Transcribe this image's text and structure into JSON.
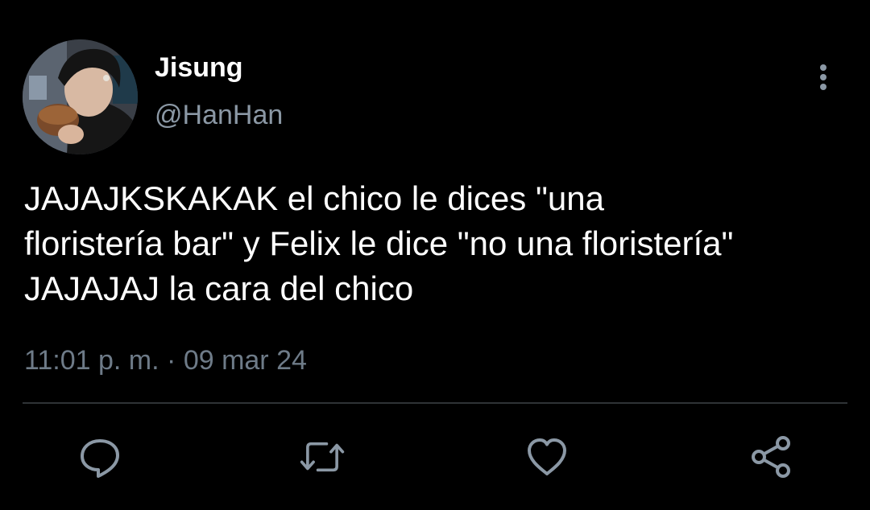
{
  "user": {
    "display_name": "Jisung",
    "handle": "@HanHan",
    "avatar_icon": "profile-photo"
  },
  "tweet": {
    "lines": [
      "JAJAJKSKAKAK el chico le dices \"una",
      "floristería bar\" y Felix le dice \"no una floristería\"",
      "JAJAJAJ la cara del chico"
    ],
    "time": "11:01 p. m.",
    "separator": "·",
    "date": "09 mar 24"
  },
  "actions": {
    "reply_icon": "speech-bubble-icon",
    "retweet_icon": "retweet-arrows-icon",
    "like_icon": "heart-icon",
    "share_icon": "share-nodes-icon"
  },
  "colors": {
    "background": "#000000",
    "primary_text": "#ffffff",
    "secondary_text": "#8b98a5",
    "icon": "#8b98a5",
    "divider": "#2f3336"
  }
}
